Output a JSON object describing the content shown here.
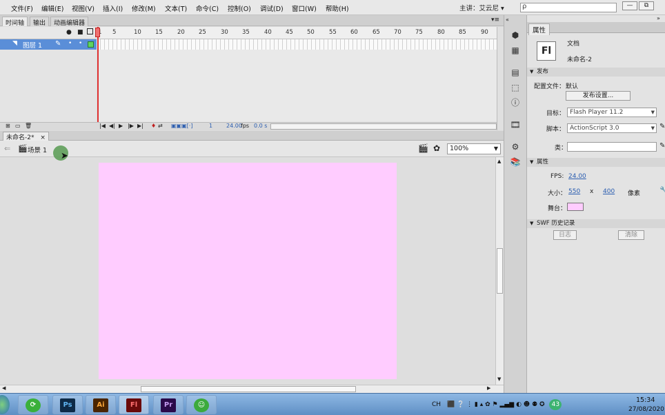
{
  "menu": {
    "items": [
      "文件(F)",
      "编辑(E)",
      "视图(V)",
      "插入(I)",
      "修改(M)",
      "文本(T)",
      "命令(C)",
      "控制(O)",
      "调试(D)",
      "窗口(W)",
      "帮助(H)"
    ],
    "presenter": "主讲：艾云尼",
    "presenter_arrow": "▾",
    "search_placeholder": "",
    "search_icon": "ρ"
  },
  "timeline": {
    "tabs": [
      "时间轴",
      "输出",
      "动画编辑器"
    ],
    "layer_name": "图层 1",
    "ruler_ticks": [
      "1",
      "5",
      "10",
      "15",
      "20",
      "25",
      "30",
      "35",
      "40",
      "45",
      "50",
      "55",
      "60",
      "65",
      "70",
      "75",
      "80",
      "85",
      "90"
    ],
    "current_frame": "1",
    "fps_value": "24.00",
    "fps_unit": "fps",
    "elapsed": "0.0 s"
  },
  "document": {
    "tab_label": "未命名-2*",
    "tab_close": "×",
    "scene_label": "场景 1",
    "zoom": "100%",
    "stage_color": "#ffccff"
  },
  "properties": {
    "tab_label": "属性",
    "doc_type": "文档",
    "doc_name": "未命名-2",
    "fl_badge": "Fl",
    "publish_section": "发布",
    "profile_label": "配置文件：",
    "profile_value": "默认",
    "publish_settings_button": "发布设置...",
    "target_label": "目标：",
    "target_value": "Flash Player 11.2",
    "script_label": "脚本：",
    "script_value": "ActionScript 3.0",
    "class_label": "类：",
    "class_value": "",
    "props_section": "属性",
    "fps_label": "FPS:",
    "fps_value": "24.00",
    "size_label": "大小：",
    "width": "550",
    "size_x": "x",
    "height": "400",
    "size_unit": "像素",
    "stage_label": "舞台：",
    "stage_color": "#ffccff",
    "swf_section": "SWF 历史记录",
    "log_button": "日志",
    "clear_button": "清除"
  },
  "taskbar": {
    "apps": [
      {
        "name": "360",
        "color": "#3ab03a"
      },
      {
        "name": "Ps",
        "color": "#0e2a47"
      },
      {
        "name": "Ai",
        "color": "#4a2500"
      },
      {
        "name": "Fl",
        "color": "#6a0a0a"
      },
      {
        "name": "Pr",
        "color": "#2a0a4a"
      },
      {
        "name": "☺",
        "color": "#3caa3c"
      }
    ],
    "tray_lang": "CH",
    "tray_badge": "43",
    "time": "15:34",
    "date": "27/08/2020"
  },
  "colors": {
    "layer_selected": "#5a8ed8",
    "playhead": "#e03030",
    "stage": "#ffccff"
  }
}
